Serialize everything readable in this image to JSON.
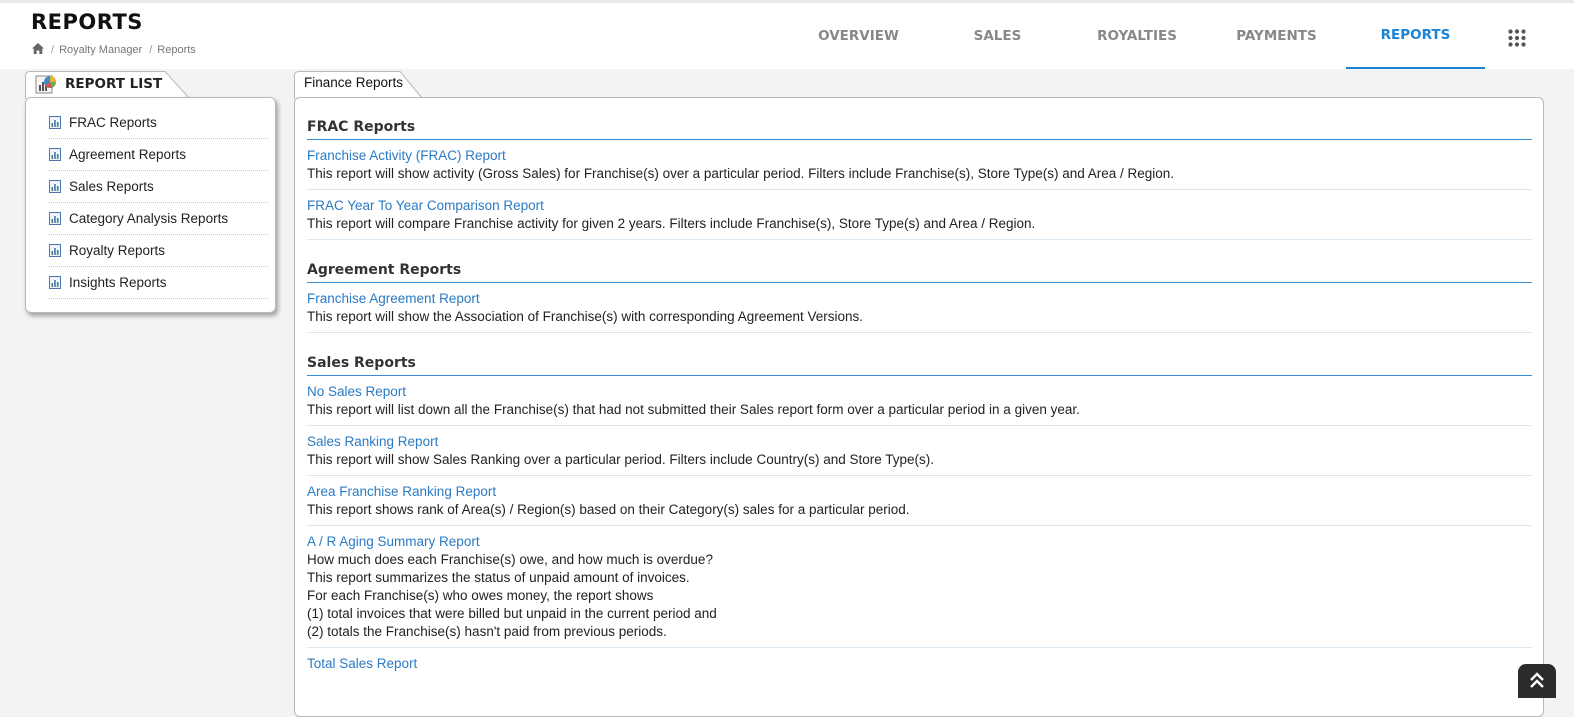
{
  "header": {
    "title": "REPORTS",
    "breadcrumb": [
      "Royalty Manager",
      "Reports"
    ]
  },
  "nav": {
    "tabs": [
      {
        "label": "OVERVIEW",
        "active": false
      },
      {
        "label": "SALES",
        "active": false
      },
      {
        "label": "ROYALTIES",
        "active": false
      },
      {
        "label": "PAYMENTS",
        "active": false
      },
      {
        "label": "REPORTS",
        "active": true
      }
    ],
    "accent_color": "#1a83d6"
  },
  "report_list": {
    "tab_label": "REPORT LIST",
    "items": [
      {
        "label": "FRAC Reports"
      },
      {
        "label": "Agreement Reports"
      },
      {
        "label": "Sales Reports"
      },
      {
        "label": "Category Analysis Reports"
      },
      {
        "label": "Royalty Reports"
      },
      {
        "label": "Insights Reports"
      }
    ]
  },
  "finance": {
    "tab_label": "Finance Reports",
    "sections": [
      {
        "title": "FRAC Reports",
        "reports": [
          {
            "name": "Franchise Activity (FRAC) Report",
            "desc": [
              "This report will show activity (Gross Sales) for Franchise(s) over a particular period. Filters include Franchise(s), Store Type(s) and Area / Region."
            ]
          },
          {
            "name": "FRAC Year To Year Comparison Report",
            "desc": [
              "This report will compare Franchise activity for given 2 years. Filters include Franchise(s), Store Type(s) and Area / Region."
            ]
          }
        ]
      },
      {
        "title": "Agreement Reports",
        "reports": [
          {
            "name": "Franchise Agreement Report",
            "desc": [
              "This report will show the Association of Franchise(s) with corresponding Agreement Versions."
            ]
          }
        ]
      },
      {
        "title": "Sales Reports",
        "reports": [
          {
            "name": "No Sales Report",
            "desc": [
              "This report will list down all the Franchise(s) that had not submitted their Sales report form over a particular period in a given year."
            ]
          },
          {
            "name": "Sales Ranking Report",
            "desc": [
              "This report will show Sales Ranking over a particular period. Filters include Country(s) and Store Type(s)."
            ]
          },
          {
            "name": "Area Franchise Ranking Report",
            "desc": [
              "This report shows rank of Area(s) / Region(s) based on their Category(s) sales for a particular period."
            ]
          },
          {
            "name": "A / R Aging Summary Report",
            "desc": [
              "How much does each Franchise(s) owe, and how much is overdue?",
              "This report summarizes the status of unpaid amount of invoices.",
              "For each Franchise(s) who owes money, the report shows",
              "(1) total invoices that were billed but unpaid in the current period and",
              "(2) totals the Franchise(s) hasn't paid from previous periods."
            ]
          },
          {
            "name": "Total Sales Report",
            "desc": []
          }
        ]
      }
    ]
  },
  "colors": {
    "link": "#2a7ac4",
    "section_rule": "#3b8bd0"
  }
}
